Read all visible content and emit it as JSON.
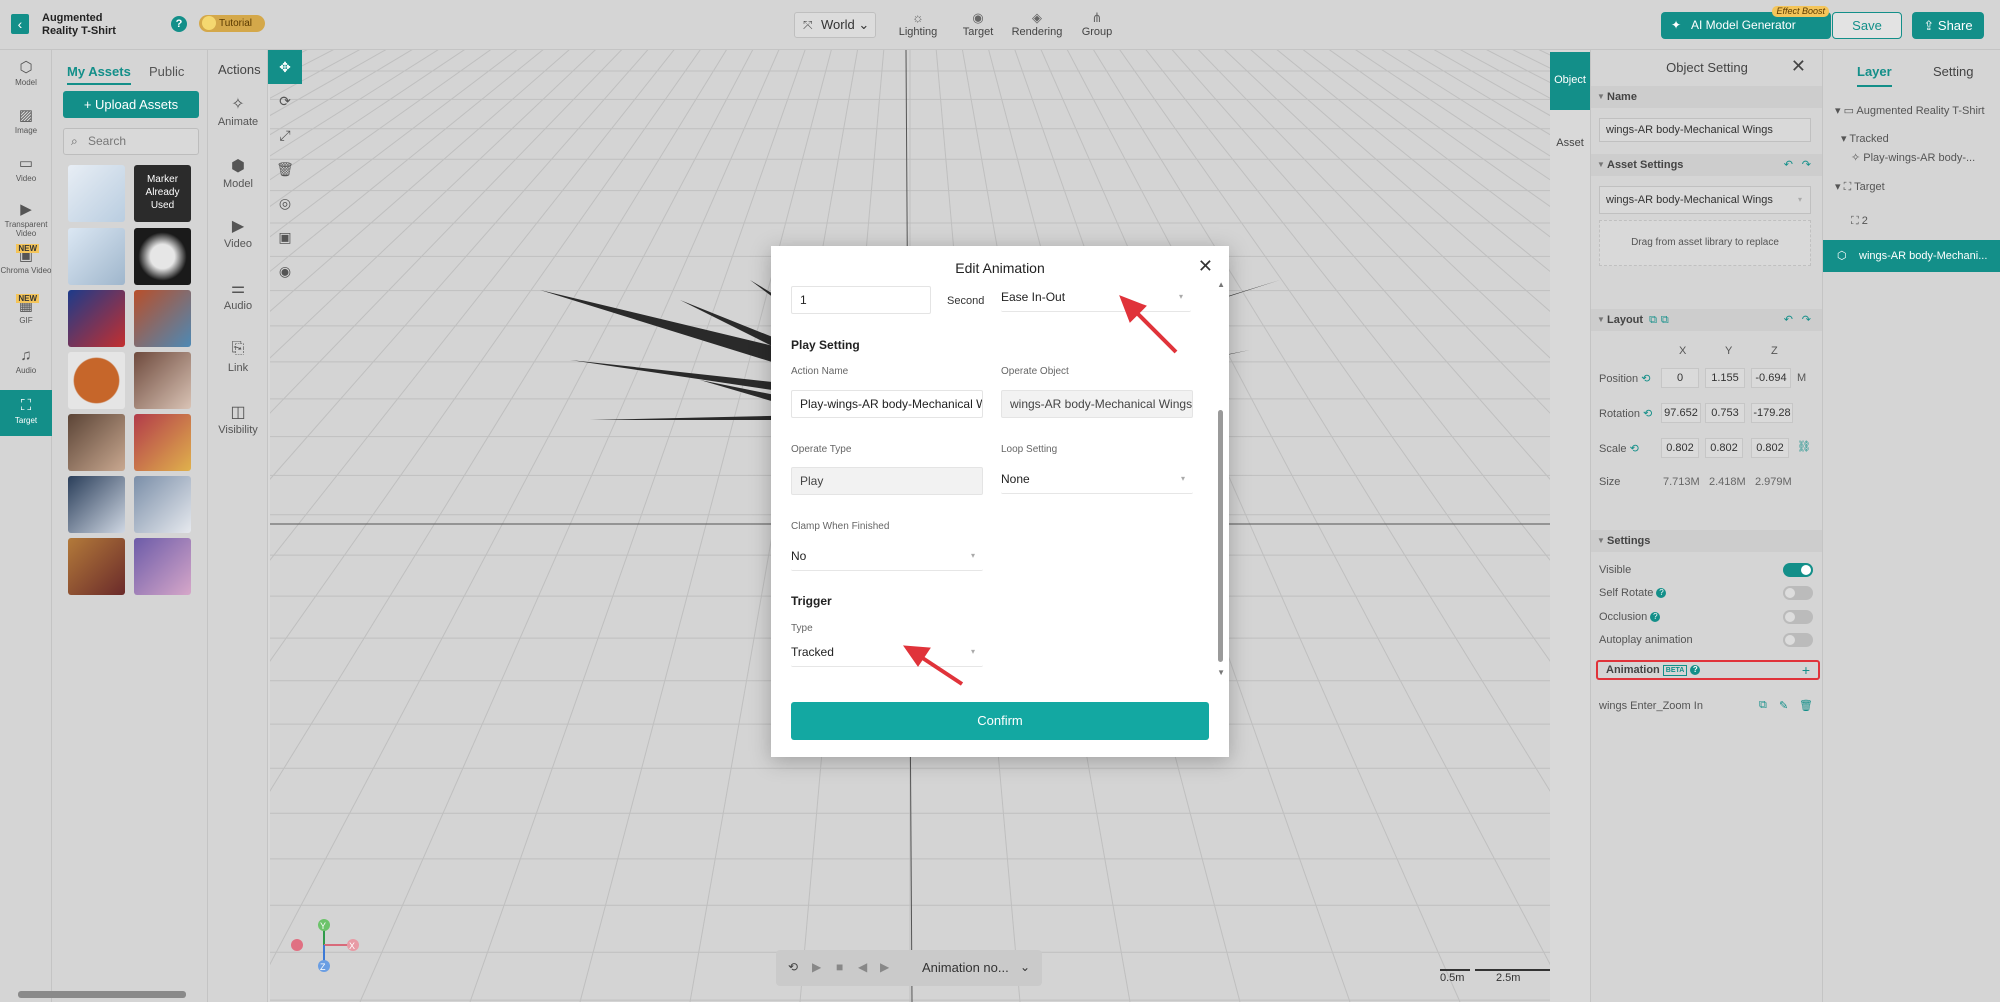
{
  "header": {
    "back_icon": "chevron-left-icon",
    "project_title": "Augmented Reality T-Shirt",
    "tutorial_label": "Tutorial",
    "world_label": "World",
    "tools": [
      {
        "label": "Lighting",
        "icon": "sun-icon"
      },
      {
        "label": "Target",
        "icon": "target-icon"
      },
      {
        "label": "Rendering",
        "icon": "paint-bucket-icon"
      },
      {
        "label": "Group",
        "icon": "group-icon"
      }
    ],
    "ai_button": "AI Model Generator",
    "ai_badge": "Effect Boost",
    "save_label": "Save",
    "share_label": "Share"
  },
  "left_nav": {
    "items": [
      {
        "label": "Model",
        "icon": "cube-icon"
      },
      {
        "label": "Image",
        "icon": "image-icon"
      },
      {
        "label": "Video",
        "icon": "ar-video-icon"
      },
      {
        "label": "Transparent Video",
        "icon": "transparent-video-icon"
      },
      {
        "label": "Chroma Video",
        "icon": "chroma-video-icon",
        "badge": "NEW"
      },
      {
        "label": "GIF",
        "icon": "gif-icon",
        "badge": "NEW"
      },
      {
        "label": "Audio",
        "icon": "music-icon"
      },
      {
        "label": "Target",
        "icon": "target-frame-icon"
      }
    ]
  },
  "assets": {
    "tab_my": "My Assets",
    "tab_public": "Public",
    "upload_label": "+ Upload Assets",
    "search_placeholder": "Search",
    "marker_text": "Marker Already Used"
  },
  "actions": {
    "title": "Actions",
    "items": [
      {
        "label": "Animate",
        "icon": "animate-icon"
      },
      {
        "label": "Model",
        "icon": "model-icon"
      },
      {
        "label": "Video",
        "icon": "video-icon"
      },
      {
        "label": "Audio",
        "icon": "audio-sliders-icon"
      },
      {
        "label": "Link",
        "icon": "link-icon"
      },
      {
        "label": "Visibility",
        "icon": "visibility-icon"
      }
    ]
  },
  "viewport": {
    "animation_select": "Animation no...",
    "scale_small": "0.5m",
    "scale_large": "2.5m",
    "axes": {
      "x": "X",
      "y": "Y",
      "z": "Z"
    }
  },
  "object_setting": {
    "side_tab_object": "Object",
    "side_tab_asset": "Asset",
    "title": "Object Setting",
    "name_section": "Name",
    "name_value": "wings-AR body-Mechanical Wings",
    "asset_settings_section": "Asset Settings",
    "asset_value": "wings-AR body-Mechanical Wings",
    "drag_hint": "Drag from asset library to replace",
    "layout_section": "Layout",
    "axis_headers": [
      "X",
      "Y",
      "Z"
    ],
    "position_label": "Position",
    "position": [
      "0",
      "1.155",
      "-0.694"
    ],
    "position_unit": "M",
    "rotation_label": "Rotation",
    "rotation": [
      "97.652",
      "0.753",
      "-179.28"
    ],
    "scale_label": "Scale",
    "scale": [
      "0.802",
      "0.802",
      "0.802"
    ],
    "size_label": "Size",
    "size": [
      "7.713M",
      "2.418M",
      "2.979M"
    ],
    "settings_section": "Settings",
    "visible_label": "Visible",
    "visible_on": 1,
    "self_rotate_label": "Self Rotate",
    "self_rotate_on": 0,
    "occlusion_label": "Occlusion",
    "occlusion_on": 0,
    "autoplay_label": "Autoplay animation",
    "autoplay_on": 0,
    "animation_label": "Animation",
    "beta_label": "BETA",
    "animation_item": "wings Enter_Zoom In"
  },
  "layer_panel": {
    "tab_layer": "Layer",
    "tab_setting": "Setting",
    "items": [
      {
        "label": "Augmented Reality T-Shirt"
      },
      {
        "label": "Tracked"
      },
      {
        "label": "Play-wings-AR body-..."
      },
      {
        "label": "Target"
      },
      {
        "label": "2"
      },
      {
        "label": "wings-AR body-Mechani..."
      }
    ]
  },
  "modal": {
    "title": "Edit Animation",
    "duration_value": "1",
    "duration_unit": "Second",
    "easing_value": "Ease In-Out",
    "play_setting_heading": "Play Setting",
    "action_name_label": "Action Name",
    "action_name_value": "Play-wings-AR body-Mechanical Wings",
    "operate_object_label": "Operate Object",
    "operate_object_value": "wings-AR body-Mechanical Wings",
    "operate_type_label": "Operate Type",
    "operate_type_value": "Play",
    "loop_setting_label": "Loop Setting",
    "loop_setting_value": "None",
    "clamp_label": "Clamp When Finished",
    "clamp_value": "No",
    "trigger_heading": "Trigger",
    "type_label": "Type",
    "type_value": "Tracked",
    "confirm_label": "Confirm"
  },
  "colors": {
    "accent": "#138f89",
    "confirm": "#13a8a2",
    "highlight": "#e0333a",
    "annotation_arrow": "#e0333a"
  }
}
